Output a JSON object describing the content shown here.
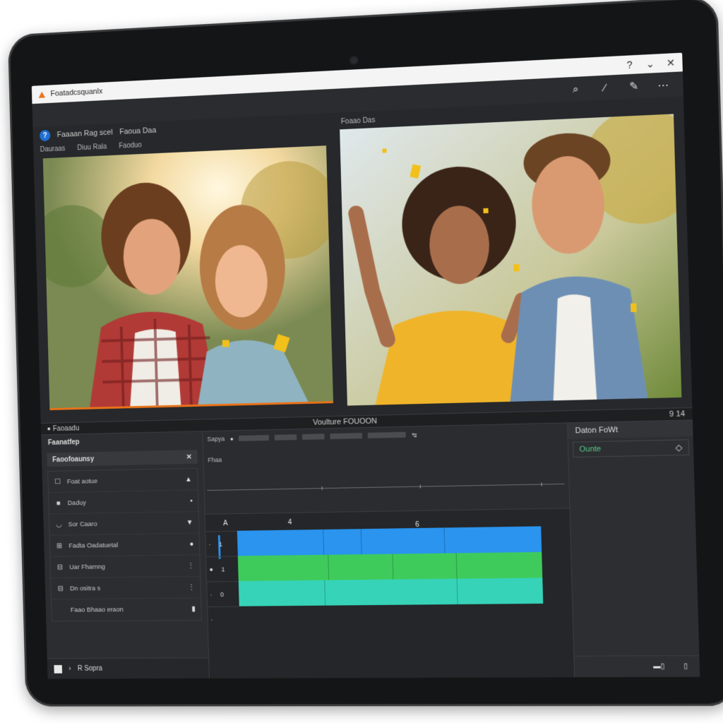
{
  "window": {
    "title": "Foatadcsquanlx",
    "controls": [
      "?",
      "⌄",
      "✕"
    ]
  },
  "toolbar": {
    "icons": [
      "search-icon",
      "brush-icon",
      "pen-icon",
      "more-icon"
    ]
  },
  "left_header": {
    "help": "?",
    "title": "Faaaan Rag scel",
    "title2": "Faoua Daa"
  },
  "left_subnav": [
    "Dauraas",
    "Diuu Rala",
    "Faoduo"
  ],
  "right_preview_label": "Foaao Das",
  "separator": {
    "left": "Faoaadu",
    "center": "Voulture FOUOON",
    "right": "9 14"
  },
  "left_panel": {
    "heading": "Faanatfep",
    "section": "Faoofoaunsy",
    "section_icon": "✕",
    "items": [
      {
        "icon": "☐",
        "label": "Foat aotue",
        "right": "▲"
      },
      {
        "icon": "■",
        "label": "Daduy",
        "right": "▪"
      },
      {
        "icon": "◡",
        "label": "Sor Caaro",
        "right": "▼"
      },
      {
        "icon": "⊞",
        "label": "Fadta Oadatuetal",
        "right": "●"
      },
      {
        "icon": "⊟",
        "label": "Uar Fharnng",
        "right": "⋮"
      },
      {
        "icon": "⊟",
        "label": "Dn ositra s",
        "right": "⋮"
      },
      {
        "icon": "",
        "label": "Faao Bhaao eraon",
        "right": "▮"
      }
    ],
    "footer": "R Sopra"
  },
  "timeline": {
    "top_label": "Sapya",
    "sub_label": "Fhaa",
    "marks": [
      "A",
      "4",
      "6"
    ],
    "tracks": [
      {
        "num": "1",
        "color": "#2a94ef"
      },
      {
        "num": "1",
        "color": "#3fcb5c"
      },
      {
        "num": "0",
        "color": "#36d3b8"
      }
    ]
  },
  "right_panel": {
    "title": "Daton FoWt",
    "field": "Ounte",
    "field_icon": "◇"
  }
}
